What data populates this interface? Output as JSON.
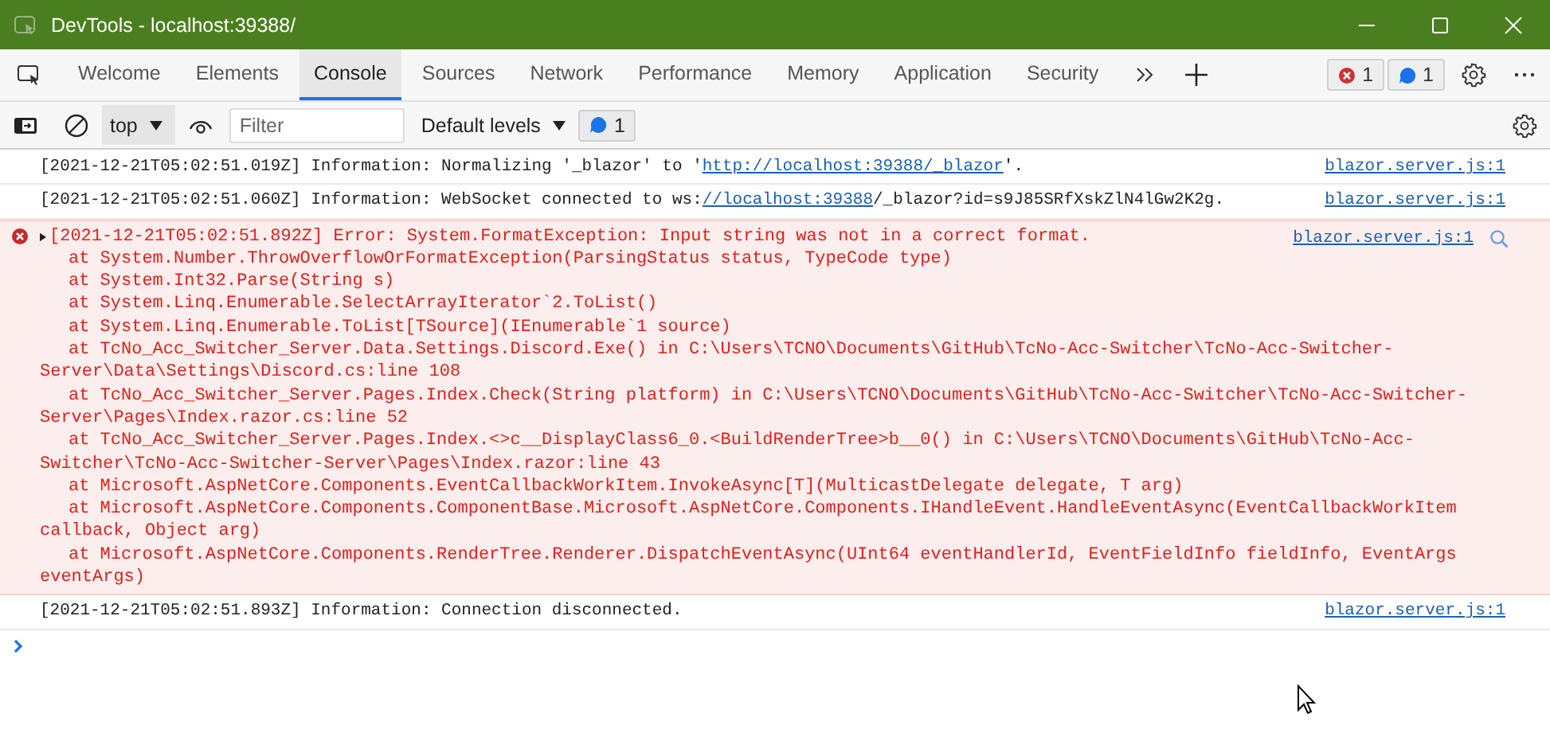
{
  "window": {
    "title": "DevTools - localhost:39388/"
  },
  "tabs": [
    {
      "label": "Welcome",
      "selected": false
    },
    {
      "label": "Elements",
      "selected": false
    },
    {
      "label": "Console",
      "selected": true
    },
    {
      "label": "Sources",
      "selected": false
    },
    {
      "label": "Network",
      "selected": false
    },
    {
      "label": "Performance",
      "selected": false
    },
    {
      "label": "Memory",
      "selected": false
    },
    {
      "label": "Application",
      "selected": false
    },
    {
      "label": "Security",
      "selected": false
    }
  ],
  "counters": [
    {
      "kind": "error",
      "count": "1"
    },
    {
      "kind": "info",
      "count": "1"
    }
  ],
  "toolbar": {
    "context": "top",
    "filter": {
      "placeholder": "Filter"
    },
    "levels": "Default levels",
    "message_count": "1"
  },
  "messages": [
    {
      "kind": "info",
      "parts": [
        {
          "text": "[2021-12-21T05:02:51.019Z] Information: Normalizing '_blazor' to '",
          "link": false
        },
        {
          "text": "http://localhost:39388/_blazor",
          "link": true
        },
        {
          "text": "'.",
          "link": false
        }
      ],
      "source": "blazor.server.js:1"
    },
    {
      "kind": "info",
      "parts": [
        {
          "text": "[2021-12-21T05:02:51.060Z] Information: WebSocket connected to ws:",
          "link": false
        },
        {
          "text": "//localhost:39388",
          "link": true
        },
        {
          "text": "/_blazor?id=s9J85SRfXskZlN4lGw2K2g.",
          "link": false
        }
      ],
      "source": "blazor.server.js:1"
    },
    {
      "kind": "error",
      "expanded": false,
      "source": "blazor.server.js:1",
      "lines": [
        {
          "text": "[2021-12-21T05:02:51.892Z] Error: System.FormatException: Input string was not in a correct format.",
          "indent": false
        },
        {
          "text": "at System.Number.ThrowOverflowOrFormatException(ParsingStatus status, TypeCode type)",
          "indent": true
        },
        {
          "text": "at System.Int32.Parse(String s)",
          "indent": true
        },
        {
          "text": "at System.Linq.Enumerable.SelectArrayIterator`2.ToList()",
          "indent": true
        },
        {
          "text": "at System.Linq.Enumerable.ToList[TSource](IEnumerable`1 source)",
          "indent": true
        },
        {
          "text": "at TcNo_Acc_Switcher_Server.Data.Settings.Discord.Exe() in C:\\Users\\TCNO\\Documents\\GitHub\\TcNo-Acc-Switcher\\TcNo-Acc-Switcher-",
          "indent": true
        },
        {
          "text": "Server\\Data\\Settings\\Discord.cs:line 108",
          "indent": false
        },
        {
          "text": "at TcNo_Acc_Switcher_Server.Pages.Index.Check(String platform) in C:\\Users\\TCNO\\Documents\\GitHub\\TcNo-Acc-Switcher\\TcNo-Acc-Switcher-",
          "indent": true
        },
        {
          "text": "Server\\Pages\\Index.razor.cs:line 52",
          "indent": false
        },
        {
          "text": "at TcNo_Acc_Switcher_Server.Pages.Index.<>c__DisplayClass6_0.<BuildRenderTree>b__0() in C:\\Users\\TCNO\\Documents\\GitHub\\TcNo-Acc-",
          "indent": true
        },
        {
          "text": "Switcher\\TcNo-Acc-Switcher-Server\\Pages\\Index.razor:line 43",
          "indent": false
        },
        {
          "text": "at Microsoft.AspNetCore.Components.EventCallbackWorkItem.InvokeAsync[T](MulticastDelegate delegate, T arg)",
          "indent": true
        },
        {
          "text": "at Microsoft.AspNetCore.Components.ComponentBase.Microsoft.AspNetCore.Components.IHandleEvent.HandleEventAsync(EventCallbackWorkItem",
          "indent": true
        },
        {
          "text": "callback, Object arg)",
          "indent": false
        },
        {
          "text": "at Microsoft.AspNetCore.Components.RenderTree.Renderer.DispatchEventAsync(UInt64 eventHandlerId, EventFieldInfo fieldInfo, EventArgs",
          "indent": true
        },
        {
          "text": "eventArgs)",
          "indent": false
        }
      ]
    },
    {
      "kind": "info",
      "parts": [
        {
          "text": "[2021-12-21T05:02:51.893Z] Information: Connection disconnected.",
          "link": false
        }
      ],
      "source": "blazor.server.js:1"
    }
  ]
}
